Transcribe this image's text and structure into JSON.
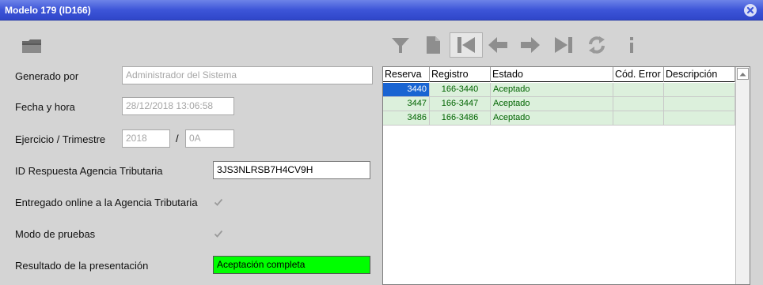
{
  "window": {
    "title": "Modelo 179 (ID166)"
  },
  "form": {
    "generado_por": {
      "label": "Generado por",
      "value": "Administrador del Sistema"
    },
    "fecha_hora": {
      "label": "Fecha y hora",
      "value": "28/12/2018  13:06:58"
    },
    "ejercicio": {
      "label": "Ejercicio / Trimestre",
      "year": "2018",
      "separator": "/",
      "trimestre": "0A"
    },
    "id_respuesta": {
      "label": "ID Respuesta Agencia Tributaria",
      "value": "3JS3NLRSB7H4CV9H"
    },
    "entregado": {
      "label": "Entregado online a la Agencia Tributaria",
      "checked": true
    },
    "modo_pruebas": {
      "label": "Modo de pruebas",
      "checked": true
    },
    "resultado": {
      "label": "Resultado de la presentación",
      "value": "Aceptación completa",
      "color": "#00ff00"
    }
  },
  "toolbar": {
    "icons": [
      "filter-icon",
      "document-icon",
      "first-record-icon",
      "previous-icon",
      "next-icon",
      "last-record-icon",
      "refresh-icon",
      "info-icon"
    ]
  },
  "grid": {
    "columns": [
      "Reserva",
      "Registro",
      "Estado",
      "Cód. Error",
      "Descripción"
    ],
    "rows": [
      {
        "reserva": "3440",
        "registro": "166-3440",
        "estado": "Aceptado",
        "cod_error": "",
        "descripcion": ""
      },
      {
        "reserva": "3447",
        "registro": "166-3447",
        "estado": "Aceptado",
        "cod_error": "",
        "descripcion": ""
      },
      {
        "reserva": "3486",
        "registro": "166-3486",
        "estado": "Aceptado",
        "cod_error": "",
        "descripcion": ""
      }
    ],
    "colors": {
      "row_bg": "#dcf0dc",
      "row_text": "#006400",
      "selected_bg": "#1964d2"
    }
  }
}
